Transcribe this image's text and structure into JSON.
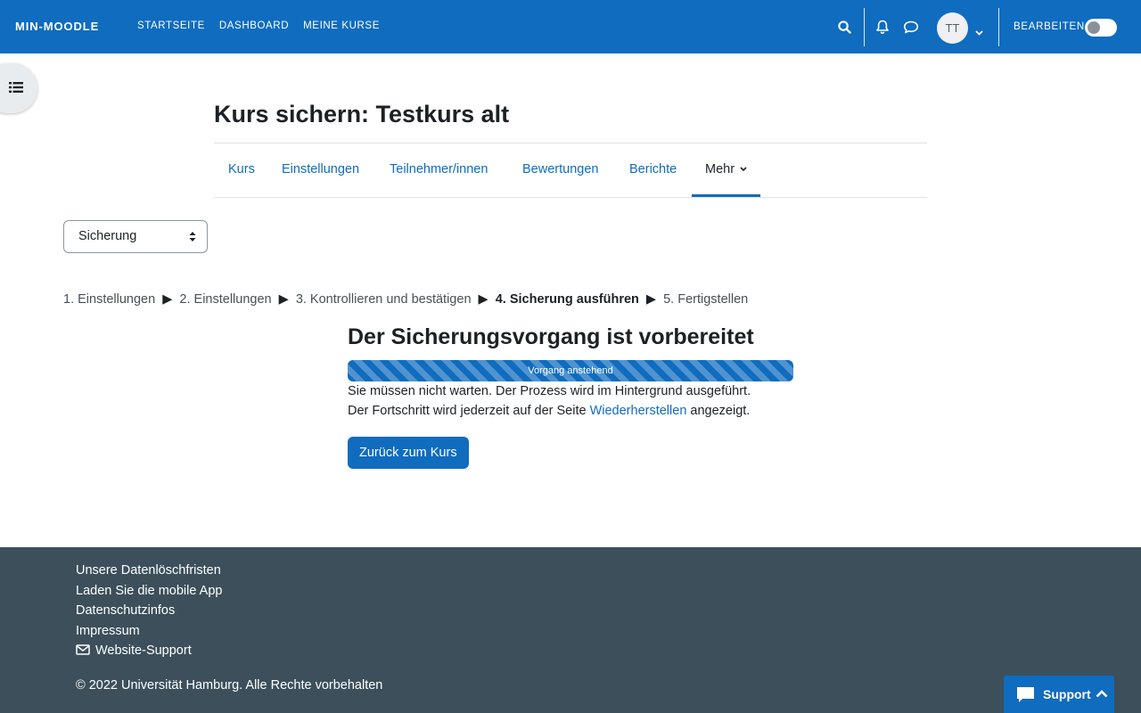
{
  "navbar": {
    "brand": "MIN-MOODLE",
    "links": [
      "STARTSEITE",
      "DASHBOARD",
      "MEINE KURSE"
    ],
    "avatar_initials": "TT",
    "edit_mode_label": "BEARBEITEN"
  },
  "page": {
    "title": "Kurs sichern: Testkurs alt"
  },
  "secondary_nav": {
    "tabs": [
      "Kurs",
      "Einstellungen",
      "Teilnehmer/innen",
      "Bewertungen",
      "Berichte"
    ],
    "more_label": "Mehr"
  },
  "select": {
    "value": "Sicherung"
  },
  "steps": {
    "s1": "1. Einstellungen",
    "s2": "2. Einstellungen",
    "s3": "3. Kontrollieren und bestätigen",
    "s4": "4. Sicherung ausführen",
    "s5": "5. Fertigstellen",
    "arrow": "▶"
  },
  "main": {
    "heading": "Der Sicherungsvorgang ist vorbereitet",
    "progress_label": "Vorgang anstehend",
    "progress_fraction": 1.0,
    "info_line1": "Sie müssen nicht warten. Der Prozess wird im Hintergrund ausgeführt.",
    "info_line2_pre": "Der Fortschritt wird jederzeit auf der Seite ",
    "info_line2_link": "Wiederherstellen",
    "info_line2_post": " angezeigt.",
    "back_button": "Zurück zum Kurs"
  },
  "footer": {
    "links": [
      "Unsere Datenlöschfristen",
      "Laden Sie die mobile App",
      "Datenschutzinfos",
      "Impressum"
    ],
    "support_link": "Website-Support",
    "copyright": "© 2022 Universität Hamburg. Alle Rechte vorbehalten"
  },
  "support_widget": {
    "label": "Support"
  },
  "colors": {
    "primary": "#0f6cbf",
    "footer_bg": "#3c4f5b"
  }
}
